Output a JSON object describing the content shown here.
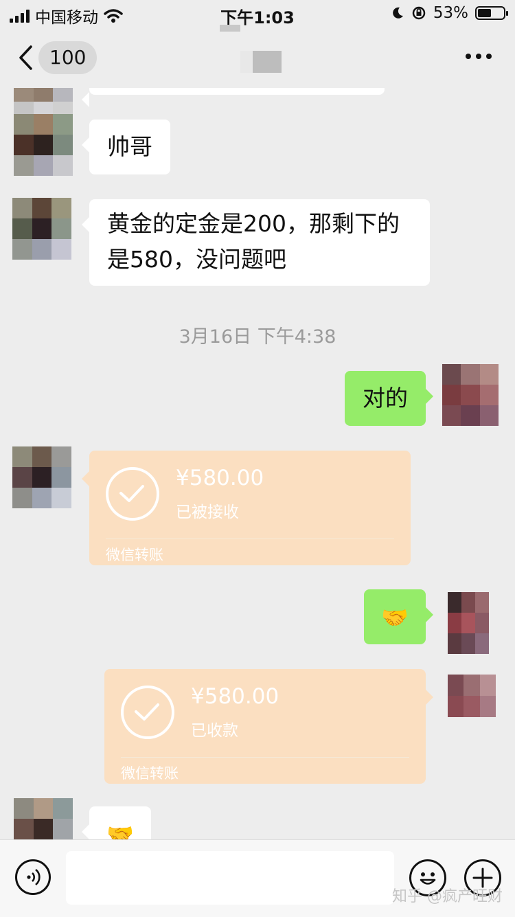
{
  "status_bar": {
    "carrier": "中国移动",
    "time": "下午1:03",
    "battery": "53%",
    "battery_level": 0.53
  },
  "nav": {
    "back_count": "100"
  },
  "messages": {
    "m1_text": "帅哥",
    "m2_text": "黄金的定金是200，那剩下的是580，没问题吧",
    "timestamp": "3月16日 下午4:38",
    "m3_text": "对的",
    "transfer1": {
      "amount": "¥580.00",
      "status": "已被接收",
      "label": "微信转账"
    },
    "m4_emoji": "🤝",
    "transfer2": {
      "amount": "¥580.00",
      "status": "已收款",
      "label": "微信转账"
    },
    "m5_emoji": "🤝"
  },
  "input_bar": {
    "placeholder": ""
  },
  "watermark": "知乎 @疯产旺财",
  "colors": {
    "background": "#ededed",
    "sent_bubble": "#95ec69",
    "transfer_card": "#fbdfc1"
  }
}
